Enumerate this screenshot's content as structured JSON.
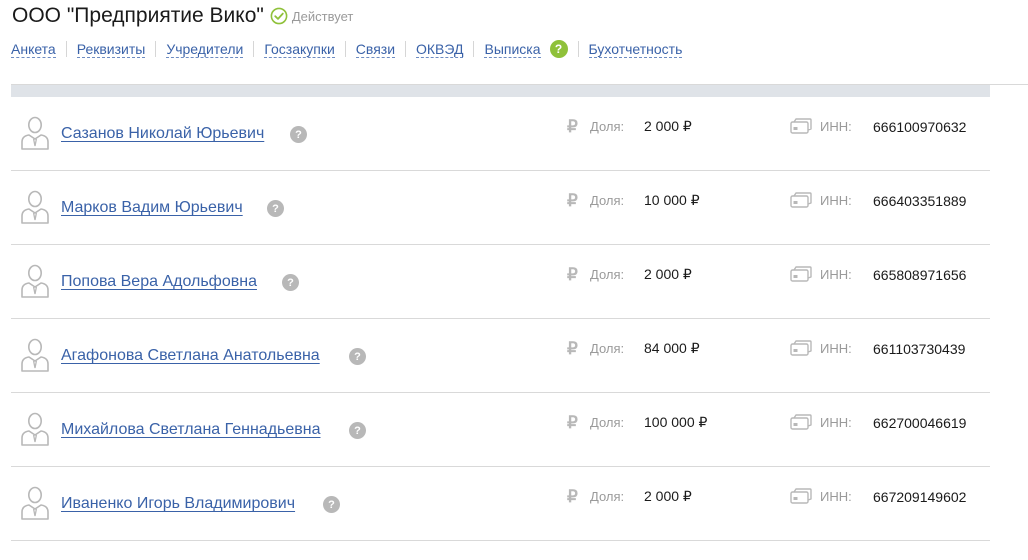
{
  "company": {
    "name": "ООО \"Предприятие Вико\"",
    "status": "Действует"
  },
  "tabs": [
    {
      "label": "Анкета"
    },
    {
      "label": "Реквизиты"
    },
    {
      "label": "Учредители"
    },
    {
      "label": "Госзакупки"
    },
    {
      "label": "Связи"
    },
    {
      "label": "ОКВЭД"
    },
    {
      "label": "Выписка"
    },
    {
      "label": "Бухотчетность"
    }
  ],
  "help_badge": "?",
  "labels": {
    "share": "Доля:",
    "inn": "ИНН:",
    "ruble": "₽",
    "question": "?"
  },
  "founders": [
    {
      "name": "Сазанов Николай Юрьевич",
      "share": "2 000 ₽",
      "inn": "666100970632"
    },
    {
      "name": "Марков Вадим Юрьевич",
      "share": "10 000 ₽",
      "inn": "666403351889"
    },
    {
      "name": "Попова Вера Адольфовна",
      "share": "2 000 ₽",
      "inn": "665808971656"
    },
    {
      "name": "Агафонова Светлана Анатольевна",
      "share": "84 000 ₽",
      "inn": "661103730439"
    },
    {
      "name": "Михайлова Светлана Геннадьевна",
      "share": "100 000 ₽",
      "inn": "662700046619"
    },
    {
      "name": "Иваненко Игорь Владимирович",
      "share": "2 000 ₽",
      "inn": "667209149602"
    }
  ],
  "colors": {
    "link": "#3a62a8",
    "status_green": "#8fc13a",
    "icon_grey": "#b8b8b8",
    "band": "#dfe3e8"
  }
}
